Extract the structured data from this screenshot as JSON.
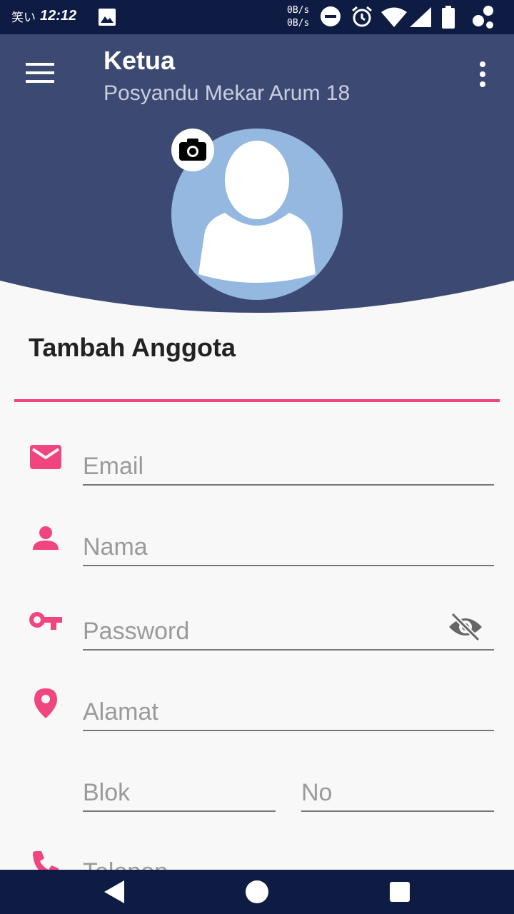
{
  "status_bar": {
    "kana": "笑い",
    "time": "12:12",
    "net_up": "0B/s",
    "net_down": "0B/s",
    "icons": [
      "image-icon",
      "dnd-icon",
      "alarm-icon",
      "wifi-icon",
      "signal-icon",
      "battery-icon",
      "app-notification-icon"
    ]
  },
  "header": {
    "title": "Ketua",
    "subtitle": "Posyandu Mekar Arum 18",
    "color": "#3c4a73"
  },
  "form": {
    "section_title": "Tambah Anggota",
    "accent_color": "#f0457f",
    "fields": {
      "email": {
        "placeholder": "Email",
        "icon": "email-icon"
      },
      "nama": {
        "placeholder": "Nama",
        "icon": "person-icon"
      },
      "password": {
        "placeholder": "Password",
        "icon": "key-icon"
      },
      "alamat": {
        "placeholder": "Alamat",
        "icon": "location-pin-icon"
      },
      "blok": {
        "placeholder": "Blok"
      },
      "no": {
        "placeholder": "No"
      },
      "telepon": {
        "placeholder": "Telepon",
        "icon": "phone-icon"
      }
    }
  },
  "nav_bar": {
    "icons": [
      "back-icon",
      "home-icon",
      "recents-icon"
    ]
  }
}
